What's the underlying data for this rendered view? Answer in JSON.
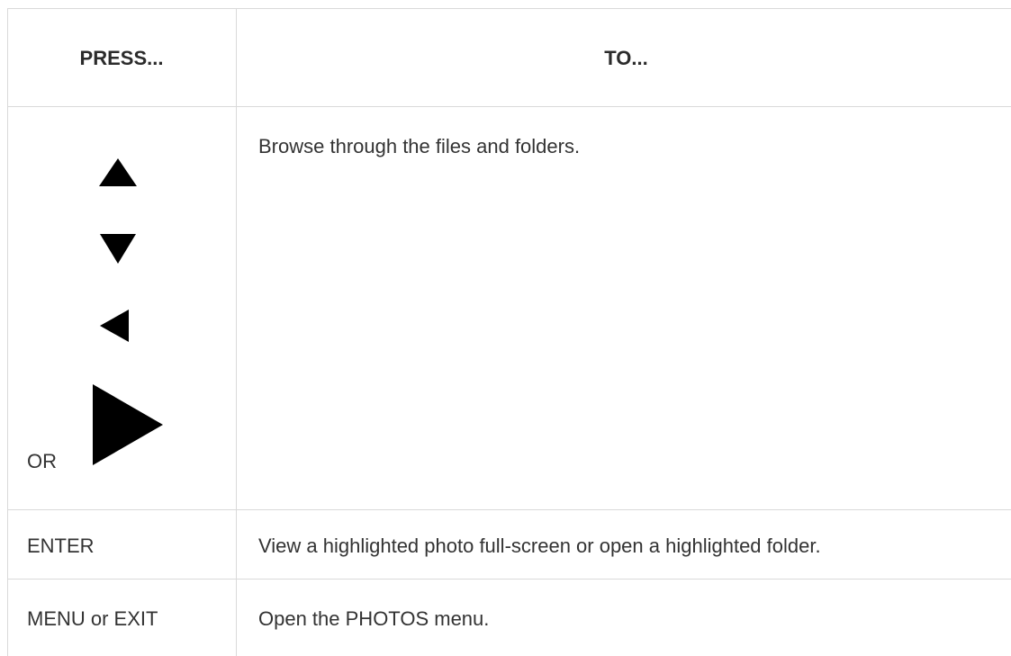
{
  "table": {
    "header": {
      "press": "PRESS...",
      "to": "TO..."
    },
    "rows": [
      {
        "press_icons": [
          "up-arrow-icon",
          "down-arrow-icon",
          "left-arrow-icon",
          "right-arrow-icon"
        ],
        "press_or": "OR",
        "to": "Browse through the files and folders."
      },
      {
        "press": "ENTER",
        "to": "View a highlighted photo full-screen or open a highlighted folder."
      },
      {
        "press": "MENU or EXIT",
        "to": "Open the PHOTOS menu."
      }
    ]
  },
  "colors": {
    "border": "#d9d9d9",
    "text": "#333333",
    "icon": "#000000"
  }
}
